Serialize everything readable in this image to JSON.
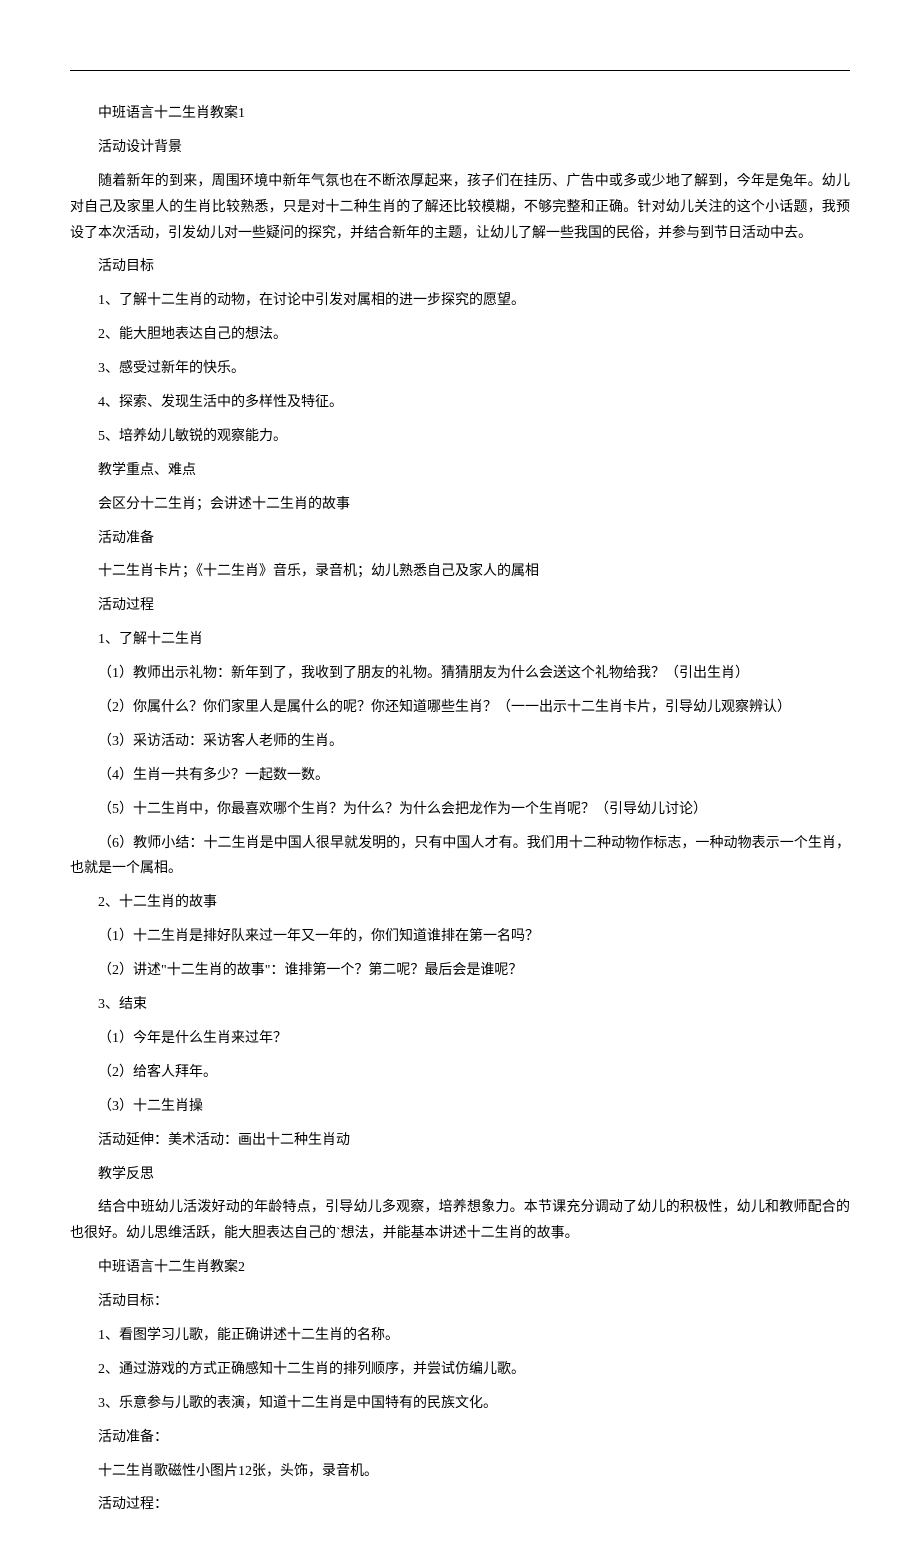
{
  "title1": "中班语言十二生肖教案1",
  "section1_heading": "活动设计背景",
  "section1_body": "随着新年的到来，周围环境中新年气氛也在不断浓厚起来，孩子们在挂历、广告中或多或少地了解到，今年是兔年。幼儿对自己及家里人的生肖比较熟悉，只是对十二种生肖的了解还比较模糊，不够完整和正确。针对幼儿关注的这个小话题，我预设了本次活动，引发幼儿对一些疑问的探究，并结合新年的主题，让幼儿了解一些我国的民俗，并参与到节日活动中去。",
  "section2_heading": "活动目标",
  "goals": [
    "1、了解十二生肖的动物，在讨论中引发对属相的进一步探究的愿望。",
    "2、能大胆地表达自己的想法。",
    "3、感受过新年的快乐。",
    "4、探索、发现生活中的多样性及特征。",
    "5、培养幼儿敏锐的观察能力。"
  ],
  "section3_heading": "教学重点、难点",
  "section3_body": "会区分十二生肖；会讲述十二生肖的故事",
  "section4_heading": "活动准备",
  "section4_body": "十二生肖卡片；《十二生肖》音乐，录音机；幼儿熟悉自己及家人的属相",
  "section5_heading": "活动过程",
  "proc1_heading": "1、了解十二生肖",
  "proc1_items": [
    "（1）教师出示礼物：新年到了，我收到了朋友的礼物。猜猜朋友为什么会送这个礼物给我？（引出生肖）",
    "（2）你属什么？你们家里人是属什么的呢？你还知道哪些生肖？（一一出示十二生肖卡片，引导幼儿观察辨认）",
    "（3）采访活动：采访客人老师的生肖。",
    "（4）生肖一共有多少？一起数一数。",
    "（5）十二生肖中，你最喜欢哪个生肖？为什么？为什么会把龙作为一个生肖呢？（引导幼儿讨论）",
    "（6）教师小结：十二生肖是中国人很早就发明的，只有中国人才有。我们用十二种动物作标志，一种动物表示一个生肖，也就是一个属相。"
  ],
  "proc2_heading": "2、十二生肖的故事",
  "proc2_items": [
    "（1）十二生肖是排好队来过一年又一年的，你们知道谁排在第一名吗？",
    "（2）讲述\"十二生肖的故事\"：谁排第一个？第二呢？最后会是谁呢？"
  ],
  "proc3_heading": "3、结束",
  "proc3_items": [
    "（1）今年是什么生肖来过年？",
    "（2）给客人拜年。",
    "（3）十二生肖操"
  ],
  "extend_label": "活动延伸：美术活动：画出十二种生肖动",
  "reflect_heading": "教学反思",
  "reflect_body": "结合中班幼儿活泼好动的年龄特点，引导幼儿多观察，培养想象力。本节课充分调动了幼儿的积极性，幼儿和教师配合的也很好。幼儿思维活跃，能大胆表达自己的`想法，并能基本讲述十二生肖的故事。",
  "title2": "中班语言十二生肖教案2",
  "section6_heading": "活动目标：",
  "goals2": [
    "1、看图学习儿歌，能正确讲述十二生肖的名称。",
    "2、通过游戏的方式正确感知十二生肖的排列顺序，并尝试仿编儿歌。",
    "3、乐意参与儿歌的表演，知道十二生肖是中国特有的民族文化。"
  ],
  "section7_heading": "活动准备：",
  "section7_body": "十二生肖歌磁性小图片12张，头饰，录音机。",
  "section8_heading": "活动过程："
}
